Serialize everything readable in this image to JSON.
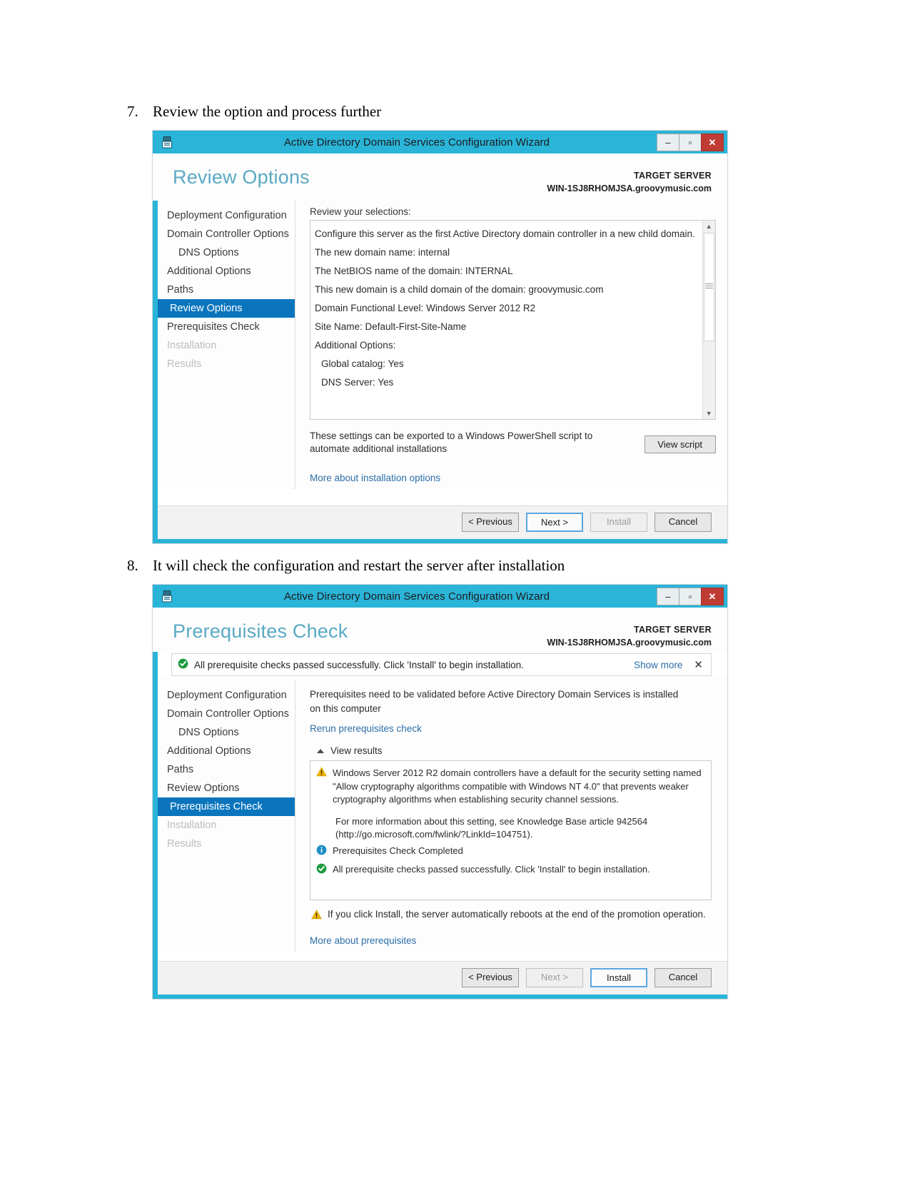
{
  "document": {
    "steps": [
      {
        "num": "7.",
        "text": "Review the option and process further"
      },
      {
        "num": "8.",
        "text": "It will check the configuration and restart the server after installation"
      }
    ]
  },
  "colors": {
    "titlebar": "#2ab4d8",
    "accent_heading": "#5aa9c4",
    "selected_nav": "#0a75bd",
    "close_button": "#bf3b34",
    "link": "#2b6ea8",
    "success_green": "#1d9b3f",
    "warning_yellow": "#f0b400",
    "info_blue": "#1e8fc6"
  },
  "wizard1": {
    "titlebar": {
      "title": "Active Directory Domain Services Configuration Wizard",
      "minimize": "–",
      "maximize": "▫",
      "close": "✕"
    },
    "page_title": "Review Options",
    "target": {
      "label": "TARGET SERVER",
      "server": "WIN-1SJ8RHOMJSA.groovymusic.com"
    },
    "nav": [
      {
        "label": "Deployment Configuration",
        "state": "normal",
        "indent": false
      },
      {
        "label": "Domain Controller Options",
        "state": "normal",
        "indent": false
      },
      {
        "label": "DNS Options",
        "state": "normal",
        "indent": true
      },
      {
        "label": "Additional Options",
        "state": "normal",
        "indent": false
      },
      {
        "label": "Paths",
        "state": "normal",
        "indent": false
      },
      {
        "label": "Review Options",
        "state": "selected",
        "indent": false
      },
      {
        "label": "Prerequisites Check",
        "state": "normal",
        "indent": false
      },
      {
        "label": "Installation",
        "state": "disabled",
        "indent": false
      },
      {
        "label": "Results",
        "state": "disabled",
        "indent": false
      }
    ],
    "review_label": "Review your selections:",
    "review_lines": [
      {
        "text": "Configure this server as the first Active Directory domain controller in a new child domain.",
        "sub": false
      },
      {
        "text": "The new domain name: internal",
        "sub": false
      },
      {
        "text": "The NetBIOS name of the domain: INTERNAL",
        "sub": false
      },
      {
        "text": "This new domain is a child domain of the domain: groovymusic.com",
        "sub": false
      },
      {
        "text": "Domain Functional Level: Windows Server 2012 R2",
        "sub": false
      },
      {
        "text": "Site Name: Default-First-Site-Name",
        "sub": false
      },
      {
        "text": "Additional Options:",
        "sub": false
      },
      {
        "text": "Global catalog: Yes",
        "sub": true
      },
      {
        "text": "DNS Server: Yes",
        "sub": true
      }
    ],
    "scrollbar": {
      "up": "▲",
      "down": "▼"
    },
    "export_text": "These settings can be exported to a Windows PowerShell script to automate additional installations",
    "view_script_button": "View script",
    "more_link": "More about installation options",
    "footer": {
      "previous": "< Previous",
      "next": "Next >",
      "install": "Install",
      "cancel": "Cancel"
    }
  },
  "wizard2": {
    "titlebar": {
      "title": "Active Directory Domain Services Configuration Wizard",
      "minimize": "–",
      "maximize": "▫",
      "close": "✕"
    },
    "page_title": "Prerequisites Check",
    "target": {
      "label": "TARGET SERVER",
      "server": "WIN-1SJ8RHOMJSA.groovymusic.com"
    },
    "notification": {
      "text": "All prerequisite checks passed successfully.  Click 'Install' to begin installation.",
      "show_more": "Show more",
      "close": "✕"
    },
    "nav": [
      {
        "label": "Deployment Configuration",
        "state": "normal",
        "indent": false
      },
      {
        "label": "Domain Controller Options",
        "state": "normal",
        "indent": false
      },
      {
        "label": "DNS Options",
        "state": "normal",
        "indent": true
      },
      {
        "label": "Additional Options",
        "state": "normal",
        "indent": false
      },
      {
        "label": "Paths",
        "state": "normal",
        "indent": false
      },
      {
        "label": "Review Options",
        "state": "normal",
        "indent": false
      },
      {
        "label": "Prerequisites Check",
        "state": "selected",
        "indent": false
      },
      {
        "label": "Installation",
        "state": "disabled",
        "indent": false
      },
      {
        "label": "Results",
        "state": "disabled",
        "indent": false
      }
    ],
    "intro_text": "Prerequisites need to be validated before Active Directory Domain Services is installed on this computer",
    "rerun_link": "Rerun prerequisites check",
    "view_results_label": "View results",
    "results": [
      {
        "icon": "warning-icon",
        "text": "Windows Server 2012 R2 domain controllers have a default for the security setting named \"Allow cryptography algorithms compatible with Windows NT 4.0\" that prevents weaker cryptography algorithms when establishing security channel sessions.",
        "sub": "For more information about this setting, see Knowledge Base article 942564 (http://go.microsoft.com/fwlink/?LinkId=104751)."
      },
      {
        "icon": "info-icon",
        "text": "Prerequisites Check Completed",
        "sub": ""
      },
      {
        "icon": "success-icon",
        "text": "All prerequisite checks passed successfully.  Click 'Install' to begin installation.",
        "sub": ""
      }
    ],
    "reboot_warning": "If you click Install, the server automatically reboots at the end of the promotion operation.",
    "more_link": "More about prerequisites",
    "footer": {
      "previous": "< Previous",
      "next": "Next >",
      "install": "Install",
      "cancel": "Cancel"
    }
  }
}
